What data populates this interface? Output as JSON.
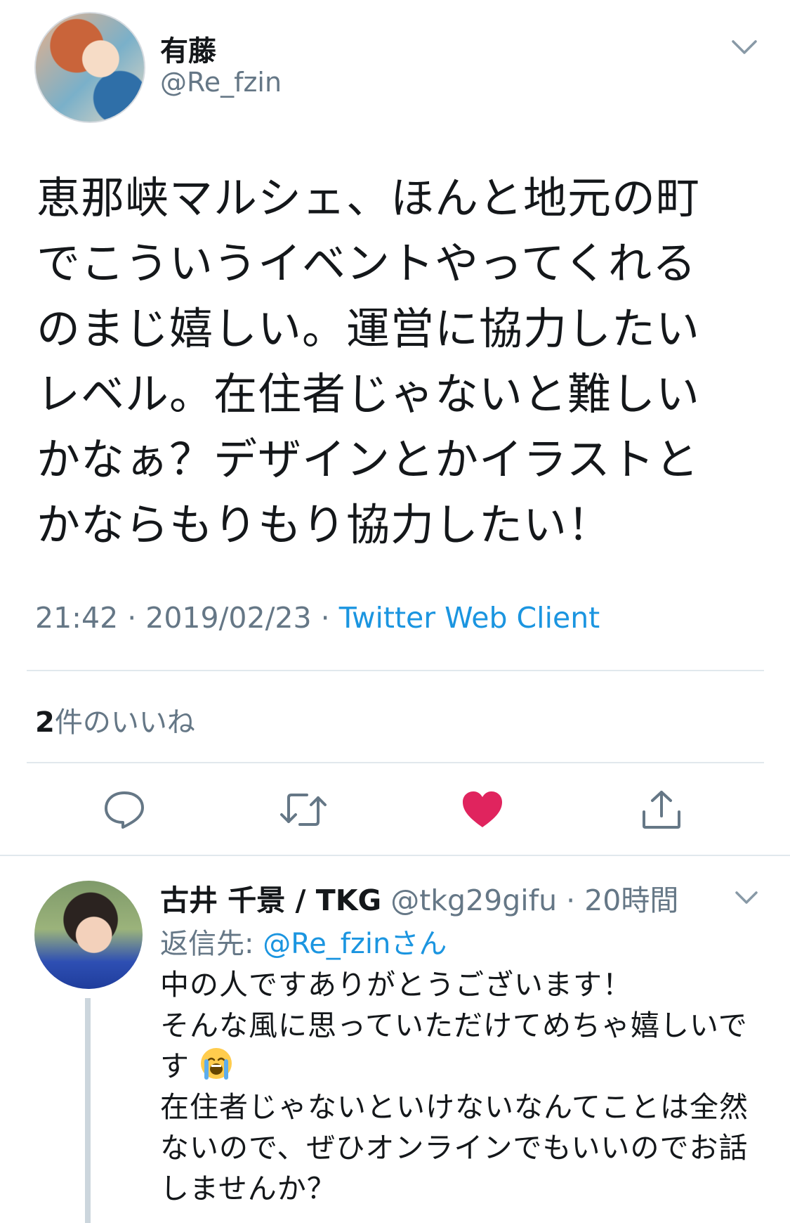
{
  "main_tweet": {
    "author_name": "有藤",
    "author_handle": "@Re_fzin",
    "text_lines": [
      "恵那峡マルシェ、ほんと地元の町",
      "でこういうイベントやってくれる",
      "のまじ嬉しい。運営に協力したい",
      "レベル。在住者じゃないと難しい",
      "かなぁ？デザインとかイラストと",
      "かならもりもり協力したい！"
    ],
    "time": "21:42",
    "date": "2019/02/23",
    "separator": " · ",
    "client": "Twitter Web Client",
    "like_count": "2",
    "like_label": "件のいいね"
  },
  "actions": {
    "reply_icon": "reply-icon",
    "retweet_icon": "retweet-icon",
    "like_icon": "heart-icon",
    "share_icon": "share-icon",
    "like_color": "#e0245e"
  },
  "reply": {
    "author_name": "古井 千景 / TKG",
    "author_handle": "@tkg29gifu",
    "dot": " · ",
    "time_ago": "20時間",
    "reply_to_prefix": "返信先: ",
    "reply_to_handle": "@Re_fzinさん",
    "text_lines": [
      "中の人ですありがとうございます！",
      "そんな風に思っていただけてめちゃ嬉しいで",
      "す",
      "在住者じゃないといけないなんてことは全然",
      "ないので、ぜひオンラインでもいいのでお話",
      "しませんか？"
    ],
    "emoji": "loudly-crying-face"
  },
  "colors": {
    "text": "#14171a",
    "secondary": "#657786",
    "link": "#1b95e0",
    "divider": "#e1e8ed"
  }
}
